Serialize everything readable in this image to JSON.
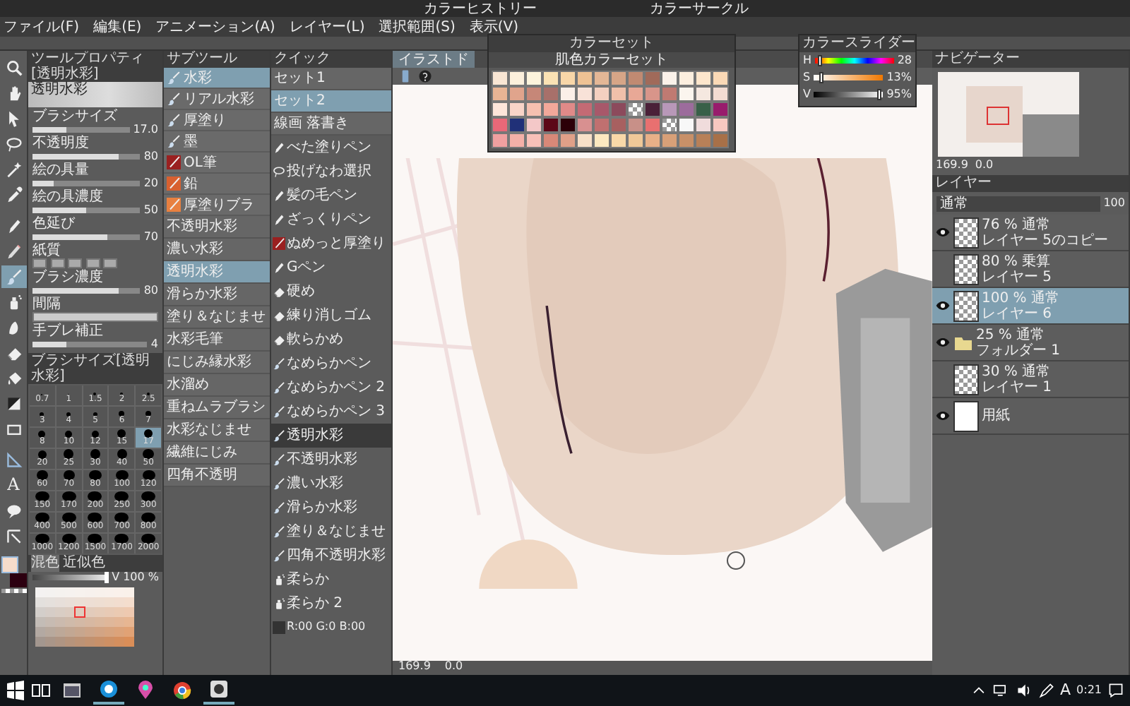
{
  "docked_palettes": [
    "カラーヒストリー",
    "カラーサークル"
  ],
  "menu": [
    "ファイル(F)",
    "編集(E)",
    "アニメーション(A)",
    "レイヤー(L)",
    "選択範囲(S)",
    "表示(V)"
  ],
  "tools": [
    {
      "kind": "zoom",
      "selected": false
    },
    {
      "kind": "hand",
      "selected": false
    },
    {
      "kind": "pointer",
      "selected": false
    },
    {
      "kind": "lasso",
      "selected": false
    },
    {
      "kind": "wand",
      "selected": false
    },
    {
      "kind": "eyedropper",
      "selected": false
    },
    {
      "kind": "pen",
      "selected": false
    },
    {
      "kind": "pencil",
      "selected": false
    },
    {
      "kind": "brush",
      "selected": true
    },
    {
      "kind": "spray",
      "selected": false
    },
    {
      "kind": "smudge",
      "selected": false
    },
    {
      "kind": "eraser",
      "selected": false
    },
    {
      "kind": "bucket",
      "selected": false
    },
    {
      "kind": "gradient",
      "selected": false
    },
    {
      "kind": "rectangle",
      "selected": false
    },
    {
      "kind": "ruler",
      "selected": false
    },
    {
      "kind": "text",
      "glyph": "A",
      "selected": false
    },
    {
      "kind": "balloon",
      "selected": false
    },
    {
      "kind": "line",
      "selected": false
    }
  ],
  "color_swatches": [
    {
      "kind": "main",
      "color": "#f6dccb"
    },
    {
      "kind": "sub",
      "color": "#2c0010"
    },
    {
      "kind": "transparent"
    }
  ],
  "tool_property": {
    "title": "ツールプロパティ[透明水彩]",
    "preview_label": "透明水彩",
    "properties": [
      {
        "kind": "slider",
        "label": "ブラシサイズ",
        "value": "17.0",
        "level": 0.35
      },
      {
        "kind": "slider",
        "label": "不透明度",
        "value": "80",
        "level": 0.8
      },
      {
        "kind": "slider",
        "label": "絵の具量",
        "value": "20",
        "level": 0.2
      },
      {
        "kind": "slider",
        "label": "絵の具濃度",
        "value": "50",
        "level": 0.5
      },
      {
        "kind": "slider",
        "label": "色延び",
        "value": "70",
        "level": 0.7
      },
      {
        "kind": "texture",
        "label": "紙質"
      },
      {
        "kind": "slider",
        "label": "ブラシ濃度",
        "value": "80",
        "level": 0.8
      },
      {
        "kind": "spacing",
        "label": "間隔"
      },
      {
        "kind": "slider",
        "label": "手ブレ補正",
        "value": "4",
        "level": 0.3
      }
    ]
  },
  "brush_size": {
    "title": "ブラシサイズ[透明水彩]",
    "sizes": [
      {
        "label": "0.7",
        "selected": false
      },
      {
        "label": "1",
        "selected": false
      },
      {
        "label": "1.5",
        "selected": false
      },
      {
        "label": "2",
        "selected": false
      },
      {
        "label": "2.5",
        "selected": false
      },
      {
        "label": "3",
        "selected": false
      },
      {
        "label": "4",
        "selected": false
      },
      {
        "label": "5",
        "selected": false
      },
      {
        "label": "6",
        "selected": false
      },
      {
        "label": "7",
        "selected": false
      },
      {
        "label": "8",
        "selected": false
      },
      {
        "label": "10",
        "selected": false
      },
      {
        "label": "12",
        "selected": false
      },
      {
        "label": "15",
        "selected": false
      },
      {
        "label": "17",
        "selected": true
      },
      {
        "label": "20",
        "selected": false
      },
      {
        "label": "25",
        "selected": false
      },
      {
        "label": "30",
        "selected": false
      },
      {
        "label": "40",
        "selected": false
      },
      {
        "label": "50",
        "selected": false
      },
      {
        "label": "60",
        "selected": false
      },
      {
        "label": "70",
        "selected": false
      },
      {
        "label": "80",
        "selected": false
      },
      {
        "label": "100",
        "selected": false
      },
      {
        "label": "120",
        "selected": false
      },
      {
        "label": "150",
        "selected": false
      },
      {
        "label": "170",
        "selected": false
      },
      {
        "label": "200",
        "selected": false
      },
      {
        "label": "250",
        "selected": false
      },
      {
        "label": "300",
        "selected": false
      },
      {
        "label": "400",
        "selected": false
      },
      {
        "label": "500",
        "selected": false
      },
      {
        "label": "600",
        "selected": false
      },
      {
        "label": "700",
        "selected": false
      },
      {
        "label": "800",
        "selected": false
      },
      {
        "label": "1000",
        "selected": false
      },
      {
        "label": "1200",
        "selected": false
      },
      {
        "label": "1500",
        "selected": false
      },
      {
        "label": "1700",
        "selected": false
      },
      {
        "label": "2000",
        "selected": false
      }
    ]
  },
  "color_mixer": {
    "tabs": [
      {
        "label": "混色",
        "selected": true
      },
      {
        "label": "近似色",
        "selected": false
      }
    ],
    "value_label": "V 100 %",
    "level": 1
  },
  "sub_tool": {
    "title": "サブツール",
    "groups": [
      {
        "label": "水彩",
        "kind": "brush",
        "selected": true
      },
      {
        "label": "リアル水彩",
        "kind": "brush",
        "selected": false
      },
      {
        "label": "厚塗り",
        "kind": "brush",
        "selected": false
      },
      {
        "label": "墨",
        "kind": "brush",
        "selected": false
      },
      {
        "label": "OL筆",
        "kind": "custom",
        "color": "#9a2020",
        "selected": false
      },
      {
        "label": "鉛",
        "kind": "custom",
        "color": "#d86030",
        "selected": false
      },
      {
        "label": "厚塗りブラ",
        "kind": "custom",
        "color": "#e88040",
        "selected": false
      }
    ],
    "items": [
      {
        "label": "不透明水彩",
        "selected": false
      },
      {
        "label": "濃い水彩",
        "selected": false
      },
      {
        "label": "透明水彩",
        "selected": true
      },
      {
        "label": "滑らか水彩",
        "selected": false
      },
      {
        "label": "塗り＆なじませ",
        "selected": false
      },
      {
        "label": "水彩毛筆",
        "selected": false
      },
      {
        "label": "にじみ縁水彩",
        "selected": false
      },
      {
        "label": "水溜め",
        "selected": false
      },
      {
        "label": "重ねムラブラシ",
        "selected": false
      },
      {
        "label": "水彩なじませ",
        "selected": false
      },
      {
        "label": "繊維にじみ",
        "selected": false
      },
      {
        "label": "四角不透明",
        "selected": false
      }
    ]
  },
  "quick_access": {
    "title": "クイック",
    "sets": [
      {
        "label": "セット1",
        "selected": false
      },
      {
        "label": "セット2",
        "selected": true
      },
      {
        "label": "線画 落書き",
        "selected": false
      }
    ],
    "items": [
      {
        "kind": "pen",
        "label": "べた塗りペン",
        "selected": false
      },
      {
        "kind": "lasso",
        "label": "投げなわ選択",
        "selected": false
      },
      {
        "kind": "pen",
        "label": "髪の毛ペン",
        "selected": false
      },
      {
        "kind": "pen",
        "label": "ざっくりペン",
        "selected": false
      },
      {
        "kind": "custom",
        "label": "ぬめっと厚塗り",
        "selected": false
      },
      {
        "kind": "pen",
        "label": "Gペン",
        "selected": false
      },
      {
        "kind": "eraser",
        "label": "硬め",
        "selected": false
      },
      {
        "kind": "eraser",
        "label": "練り消しゴム",
        "selected": false
      },
      {
        "kind": "eraser",
        "label": "軟らかめ",
        "selected": false
      },
      {
        "kind": "brush",
        "label": "なめらかペン",
        "selected": false
      },
      {
        "kind": "brush",
        "label": "なめらかペン 2",
        "selected": false
      },
      {
        "kind": "brush",
        "label": "なめらかペン 3",
        "selected": false
      },
      {
        "kind": "brush",
        "label": "透明水彩",
        "selected": true
      },
      {
        "kind": "brush",
        "label": "不透明水彩",
        "selected": false
      },
      {
        "kind": "brush",
        "label": "濃い水彩",
        "selected": false
      },
      {
        "kind": "brush",
        "label": "滑らか水彩",
        "selected": false
      },
      {
        "kind": "brush",
        "label": "塗り＆なじませ",
        "selected": false
      },
      {
        "kind": "brush",
        "label": "四角不透明水彩",
        "selected": false
      },
      {
        "kind": "spray",
        "label": "柔らか",
        "selected": false
      },
      {
        "kind": "spray",
        "label": "柔らか 2",
        "selected": false
      },
      {
        "kind": "color",
        "label": "R:00 G:0 B:00",
        "selected": false
      }
    ]
  },
  "canvas": {
    "tab": "イラストド",
    "zoom": "169.9",
    "angle": "0.0"
  },
  "color_set": {
    "title": "カラーセット",
    "set_name": "肌色カラーセット",
    "swatches": [
      {
        "color": "#f9e6d4"
      },
      {
        "color": "#fcf0dc"
      },
      {
        "color": "#fdf4dc"
      },
      {
        "color": "#fbe2b4"
      },
      {
        "color": "#f8d6a8"
      },
      {
        "color": "#efc294"
      },
      {
        "color": "#e4b796"
      },
      {
        "color": "#d6a587"
      },
      {
        "color": "#c08a72"
      },
      {
        "color": "#a06a5a"
      },
      {
        "color": "#fbf2ea"
      },
      {
        "color": "#fcefdf"
      },
      {
        "color": "#fde6cc"
      },
      {
        "color": "#fbd9b6"
      },
      {
        "color": "#e8b494"
      },
      {
        "color": "#e0a48c"
      },
      {
        "color": "#c68778"
      },
      {
        "color": "#a8706a"
      },
      {
        "color": "#fbefe8"
      },
      {
        "color": "#f8e2d8"
      },
      {
        "color": "#f4d0c0"
      },
      {
        "color": "#f0c0aa"
      },
      {
        "color": "#e8a896"
      },
      {
        "color": "#d8958a"
      },
      {
        "color": "#c07a72"
      },
      {
        "color": "#fbf5ee"
      },
      {
        "color": "#f5e8e0"
      },
      {
        "color": "#f3dcd2"
      },
      {
        "color": "#fde5da"
      },
      {
        "color": "#f9d4c8"
      },
      {
        "color": "#f6c0b0"
      },
      {
        "color": "#f2a89a"
      },
      {
        "color": "#e08a88"
      },
      {
        "color": "#c46a74"
      },
      {
        "color": "#a8586a"
      },
      {
        "color": "#8c4a5c"
      },
      {
        "kind": "transparent"
      },
      {
        "color": "#4a2038"
      },
      {
        "color": "#b898b8"
      },
      {
        "color": "#9c6c9c"
      },
      {
        "color": "#386048"
      },
      {
        "color": "#981c6c"
      },
      {
        "color": "#e86878"
      },
      {
        "color": "#203078"
      },
      {
        "color": "#f4c8c8"
      },
      {
        "color": "#5c0818"
      },
      {
        "color": "#2c0008"
      },
      {
        "color": "#d89090"
      },
      {
        "color": "#c07070"
      },
      {
        "color": "#a86060"
      },
      {
        "color": "#c89088"
      },
      {
        "color": "#e87070"
      },
      {
        "kind": "transparent"
      },
      {
        "color": "#f8f8f8"
      },
      {
        "color": "#f0dcdc"
      },
      {
        "color": "#f8c8c0"
      },
      {
        "color": "#f0a0a0"
      },
      {
        "color": "#f4b0a8"
      },
      {
        "color": "#f8c0b8"
      },
      {
        "color": "#d88878"
      },
      {
        "color": "#e0a088"
      },
      {
        "color": "#f8e0c8"
      },
      {
        "color": "#fce8c0"
      },
      {
        "color": "#f8d8a8"
      },
      {
        "color": "#f0c898"
      },
      {
        "color": "#e8b088"
      },
      {
        "color": "#d8a078"
      },
      {
        "color": "#c89068"
      },
      {
        "color": "#b88058"
      },
      {
        "color": "#a87048"
      }
    ]
  },
  "color_slider": {
    "title": "カラースライダー",
    "channels": [
      {
        "label": "H",
        "value": "28",
        "level": 0.08
      },
      {
        "label": "S",
        "value": "13%",
        "level": 0.13
      },
      {
        "label": "V",
        "value": "95%",
        "level": 0.95
      }
    ]
  },
  "navigator": {
    "title": "ナビゲーター",
    "zoom": "169.9",
    "angle": "0.0"
  },
  "layers": {
    "tab": "レイヤー",
    "blend_mode": "通常",
    "opacity": "100",
    "items": [
      {
        "kind": "layer",
        "mode": "76 % 通常",
        "name": "レイヤー 5のコピー",
        "visible": true,
        "selected": false
      },
      {
        "kind": "layer",
        "mode": "80 % 乗算",
        "name": "レイヤー 5",
        "visible": false,
        "selected": false
      },
      {
        "kind": "layer",
        "mode": "100 % 通常",
        "name": "レイヤー 6",
        "visible": true,
        "selected": true
      },
      {
        "kind": "folder",
        "mode": "25 % 通常",
        "name": "フォルダー 1",
        "visible": true,
        "selected": false
      },
      {
        "kind": "layer",
        "mode": "30 % 通常",
        "name": "レイヤー 1",
        "visible": false,
        "selected": false
      },
      {
        "kind": "paper",
        "name": "用紙",
        "visible": true,
        "selected": false
      }
    ]
  },
  "taskbar": {
    "apps": [
      {
        "kind": "window",
        "running": false
      },
      {
        "kind": "chat",
        "running": true
      },
      {
        "kind": "map",
        "running": false
      },
      {
        "kind": "browser",
        "running": false
      },
      {
        "kind": "paint",
        "running": true
      }
    ],
    "ime": "A",
    "time": "0:21"
  }
}
